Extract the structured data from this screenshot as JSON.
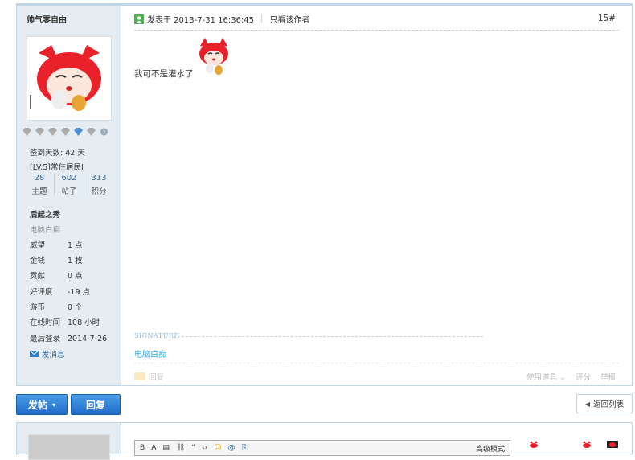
{
  "user": {
    "name": "帅气零自由",
    "checkin": "签到天数: 42 天",
    "level": "[LV.5]常住居民I",
    "stats": [
      {
        "value": "28",
        "label": "主题"
      },
      {
        "value": "602",
        "label": "帖子"
      },
      {
        "value": "313",
        "label": "积分"
      }
    ],
    "group": "后起之秀",
    "custom_title": "电脑白痴",
    "props": [
      {
        "key": "威望",
        "value": "1 点"
      },
      {
        "key": "金钱",
        "value": "1 枚"
      },
      {
        "key": "贡献",
        "value": "0 点"
      },
      {
        "key": "好评度",
        "value": "-19 点"
      },
      {
        "key": "游币",
        "value": "0 个"
      },
      {
        "key": "在线时间",
        "value": "108 小时"
      },
      {
        "key": "最后登录",
        "value": "2014-7-26"
      }
    ],
    "message_label": "发消息"
  },
  "post": {
    "posted_at": "发表于 2013-7-31 16:36:45",
    "author_only": "只看该作者",
    "floor": "15#",
    "content": "我可不是灌水了",
    "signature_heading": "SIGNATURE",
    "signature": "电脑白痴",
    "reply": "回复",
    "tools": "使用道具",
    "rate": "评分",
    "report": "举报"
  },
  "actions": {
    "new_post": "发帖",
    "reply": "回复",
    "back_list": "返回列表"
  },
  "editor": {
    "advanced_mode": "高级模式"
  },
  "colors": {
    "border": "#c2d5e3",
    "sidebar_bg": "#e5edf2",
    "button_blue": "#1f6bc9",
    "link_blue": "#336699",
    "signature": "#33aaee"
  }
}
